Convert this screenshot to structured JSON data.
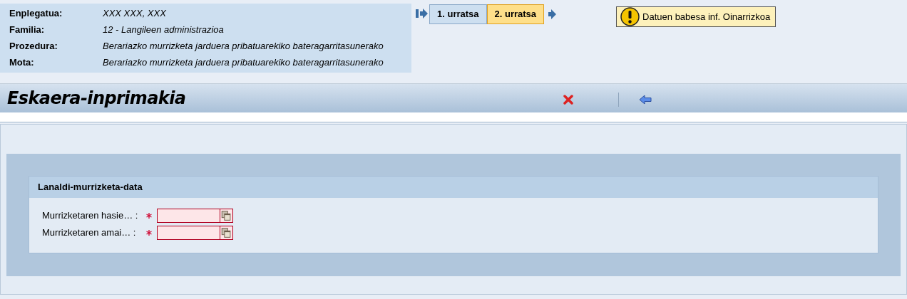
{
  "info": [
    {
      "label": "Enplegatua:",
      "value": "XXX XXX, XXX"
    },
    {
      "label": "Familia:",
      "value": "12 - Langileen administrazioa"
    },
    {
      "label": "Prozedura:",
      "value": "Berariazko murrizketa jarduera pribatuarekiko bateragarritasunerako"
    },
    {
      "label": "Mota:",
      "value": "Berariazko murrizketa jarduera pribatuarekiko bateragarritasunerako"
    }
  ],
  "steps": [
    {
      "label": "1. urratsa",
      "selected": false
    },
    {
      "label": "2. urratsa",
      "selected": true
    }
  ],
  "notice": {
    "label": "Datuen babesa inf. Oinarrizkoa"
  },
  "header": {
    "title": "Eskaera-inprimakia"
  },
  "section": {
    "title": "Lanaldi-murrizketa-data",
    "fields": [
      {
        "label": "Murrizketaren hasie… :",
        "required": true
      },
      {
        "label": "Murrizketaren amai… :",
        "required": true
      }
    ]
  }
}
